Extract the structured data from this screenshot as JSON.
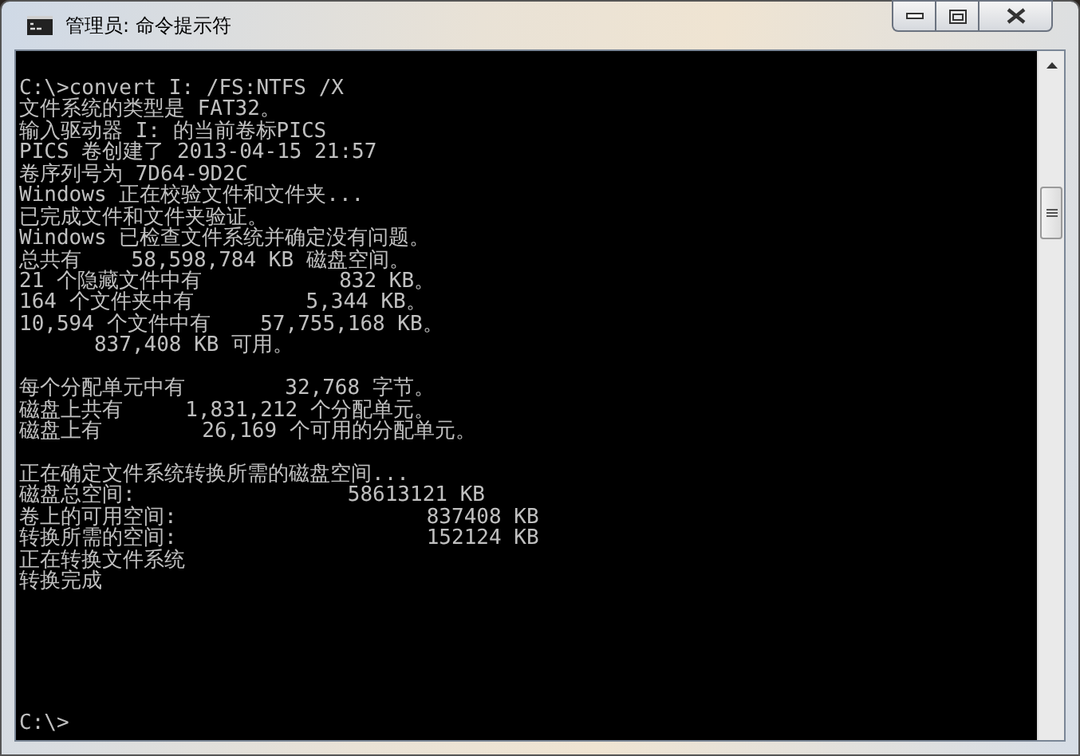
{
  "window": {
    "title": "管理员: 命令提示符"
  },
  "console": {
    "blocks": [
      [
        "C:\\>convert I: /FS:NTFS /X",
        "文件系统的类型是 FAT32。",
        "输入驱动器 I: 的当前卷标PICS",
        "PICS 卷创建了 2013-04-15 21:57",
        "卷序列号为 7D64-9D2C",
        "Windows 正在校验文件和文件夹...",
        "已完成文件和文件夹验证。",
        "Windows 已检查文件系统并确定没有问题。",
        "总共有    58,598,784 KB 磁盘空间。",
        "21 个隐藏文件中有           832 KB。",
        "164 个文件夹中有         5,344 KB。",
        "10,594 个文件中有    57,755,168 KB。",
        "      837,408 KB 可用。"
      ],
      [
        "每个分配单元中有        32,768 字节。",
        "磁盘上共有     1,831,212 个分配单元。",
        "磁盘上有        26,169 个可用的分配单元。"
      ],
      [
        "正在确定文件系统转换所需的磁盘空间...",
        "磁盘总空间:                 58613121 KB",
        "卷上的可用空间:                    837408 KB",
        "转换所需的空间:                    152124 KB",
        "正在转换文件系统",
        "转换完成"
      ]
    ],
    "prompt": "C:\\>"
  }
}
